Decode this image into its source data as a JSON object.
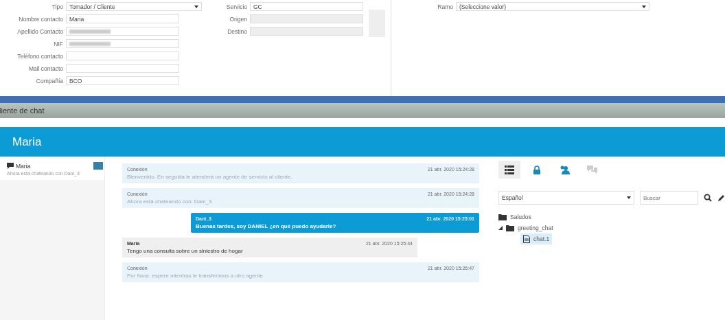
{
  "contact_form": {
    "fields": [
      {
        "label": "Tipo",
        "kind": "select",
        "value": "Tomador / Cliente"
      },
      {
        "label": "Nombre contacto",
        "kind": "text",
        "value": "Maria"
      },
      {
        "label": "Apellido Contacto",
        "kind": "redacted"
      },
      {
        "label": "NIF",
        "kind": "redacted"
      },
      {
        "label": "Teléfono contacto",
        "kind": "text"
      },
      {
        "label": "Mail contacto",
        "kind": "text"
      },
      {
        "label": "Compañía",
        "kind": "text",
        "value": "BCO"
      }
    ]
  },
  "route_form": {
    "fields": [
      {
        "label": "Servicio",
        "kind": "text",
        "value": "GC"
      },
      {
        "label": "Origen",
        "kind": "disabled"
      },
      {
        "label": "Destino",
        "kind": "disabled"
      }
    ]
  },
  "ramo": {
    "label": "Ramo",
    "value": "(Seleccione valor)"
  },
  "window": {
    "title": "liente de chat"
  },
  "chat_header": {
    "title": "Maria"
  },
  "conversations": [
    {
      "name": "Maria",
      "preview": "Ahora está chateando con Dani_3"
    }
  ],
  "messages": [
    {
      "kind": "system",
      "author": "Conexión",
      "time": "21 abr. 2020 15:24:28",
      "text": "Bienvenido. En seguida le atenderá un agente de servicio al cliente."
    },
    {
      "kind": "system",
      "author": "Conexión",
      "time": "21 abr. 2020 15:24:28",
      "text": "Ahora está chateando con: Dani_3"
    },
    {
      "kind": "agent",
      "author": "Dani_3",
      "time": "21 abr. 2020 15:25:01",
      "text": "Buenas tardes, soy DANIEL ¿en qué puedo ayudarle?"
    },
    {
      "kind": "customer",
      "author": "Maria",
      "time": "21 abr. 2020 15:25:44",
      "text": "Tengo una consulta sobre un siniestro de hogar"
    },
    {
      "kind": "system",
      "author": "Conexión",
      "time": "21 abr. 2020 15:26:47",
      "text": "Por favor, espere mientras le transferimos a otro agente"
    }
  ],
  "side_tabs": [
    {
      "kind": "list",
      "selected": true,
      "disabled": false
    },
    {
      "kind": "lock",
      "selected": false,
      "disabled": false
    },
    {
      "kind": "user",
      "selected": false,
      "disabled": false
    },
    {
      "kind": "chat",
      "selected": false,
      "disabled": true
    }
  ],
  "language_select": {
    "value": "Español"
  },
  "search": {
    "placeholder": "Buscar"
  },
  "tree": [
    {
      "label": "Saludos",
      "selected": false
    },
    {
      "label": "greeting_chat",
      "expanded": true,
      "selected": false,
      "children": [
        {
          "label": "chat.1",
          "selected": true
        }
      ]
    }
  ]
}
